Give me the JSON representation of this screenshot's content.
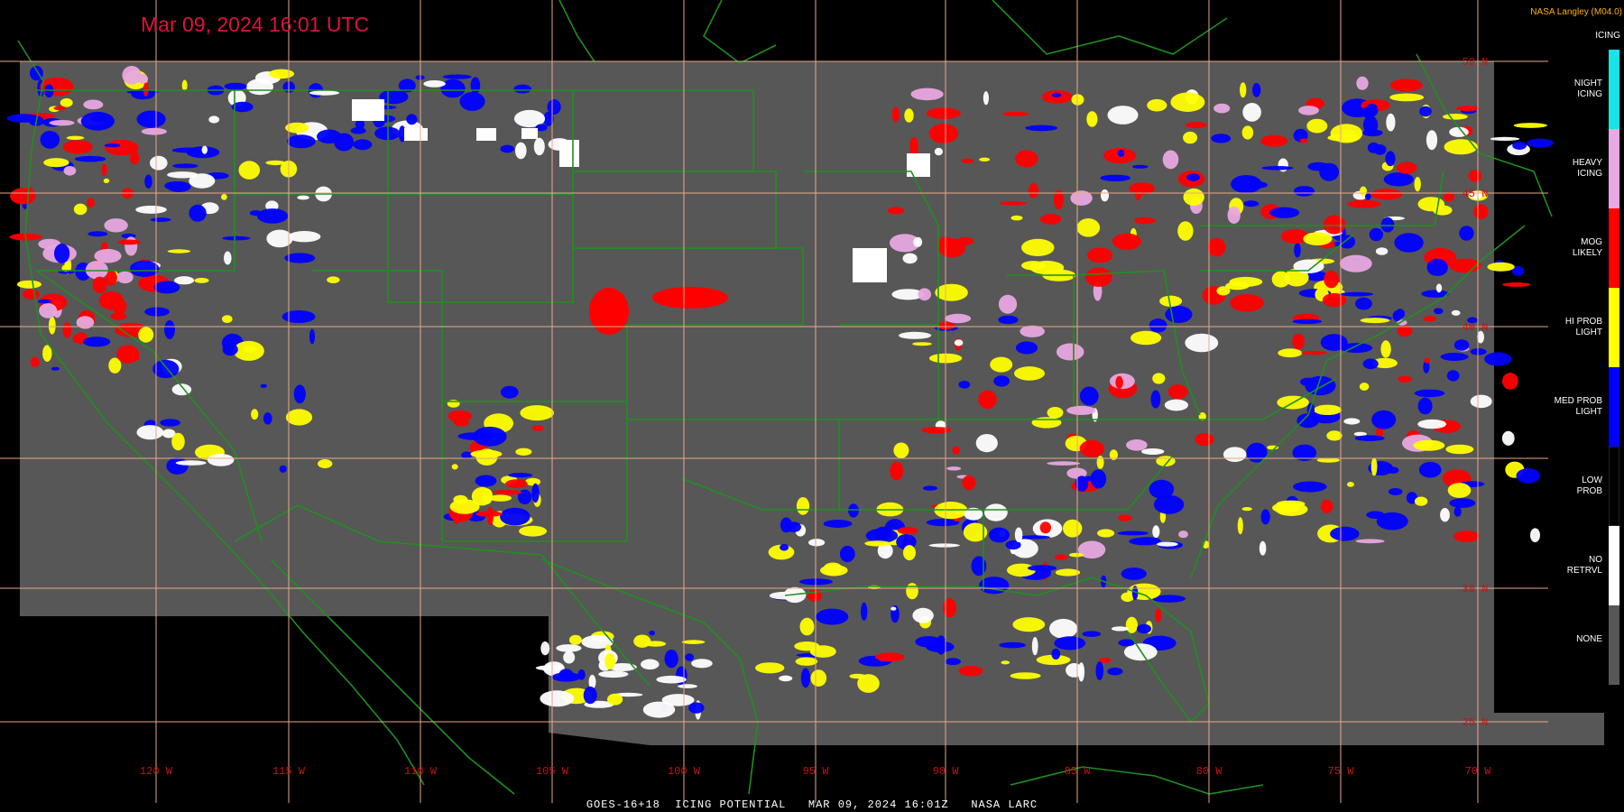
{
  "header": {
    "timestamp": "Mar 09, 2024 16:01 UTC",
    "credit": "NASA Langley (M04.0)"
  },
  "footer": {
    "caption": "GOES-16+18  ICING POTENTIAL   MAR 09, 2024 16:01Z   NASA LARC"
  },
  "map": {
    "longitude_labels": [
      "120 W",
      "115 W",
      "110 W",
      "105 W",
      "100 W",
      "95 W",
      "90 W",
      "85 W",
      "80 W",
      "75 W",
      "70 W"
    ],
    "latitude_labels": [
      "50 N",
      "45 N",
      "40 N",
      "30 N",
      "25 N"
    ],
    "colors": {
      "background": "#000000",
      "coverage": "#575757",
      "grid": "#e8a888",
      "borders": "#1f8f1f",
      "lon_label": "#cc1010",
      "lat_label": "#cc1010"
    }
  },
  "legend": {
    "title": "ICING",
    "categories": [
      {
        "label": "NIGHT\nICING",
        "color": "#18e4e8"
      },
      {
        "label": "HEAVY\nICING",
        "color": "#e8a8e0"
      },
      {
        "label": "MOG\nLIKELY",
        "color": "#ff0000"
      },
      {
        "label": "HI PROB\nLIGHT",
        "color": "#ffff00"
      },
      {
        "label": "MED PROB\nLIGHT",
        "color": "#0000ff"
      },
      {
        "label": "LOW\nPROB",
        "color": "#000000"
      },
      {
        "label": "NO\nRETRVL",
        "color": "#ffffff"
      },
      {
        "label": "NONE",
        "color": "#575757"
      }
    ]
  }
}
